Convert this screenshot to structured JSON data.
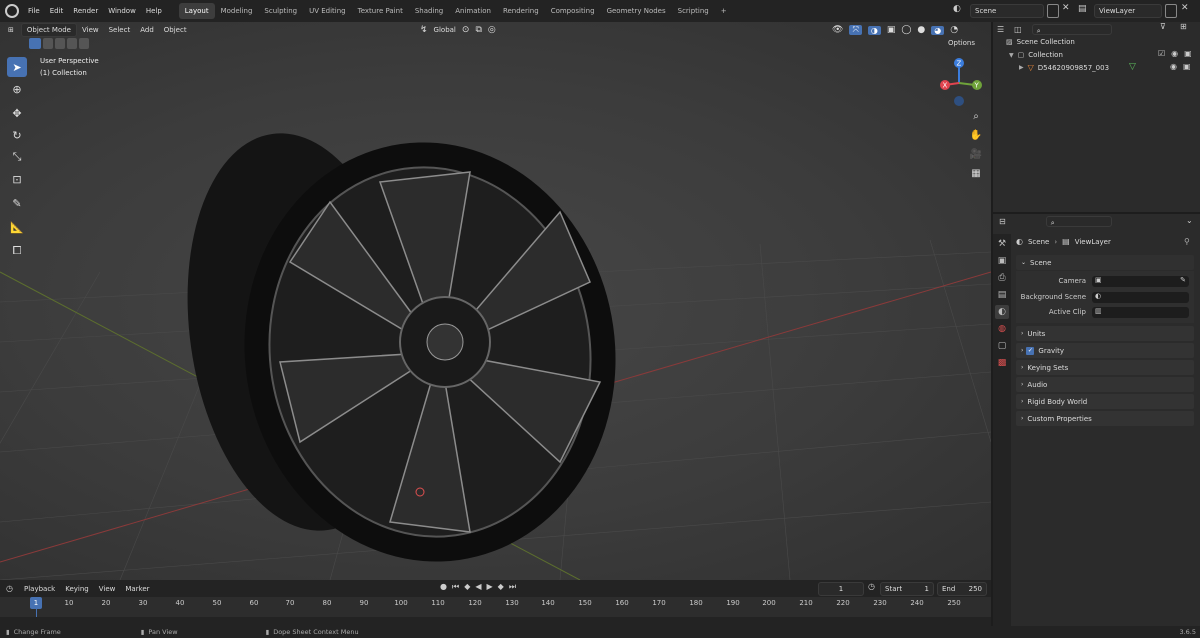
{
  "menubar": {
    "items": [
      "File",
      "Edit",
      "Render",
      "Window",
      "Help"
    ]
  },
  "workspace_tabs": [
    "Layout",
    "Modeling",
    "Sculpting",
    "UV Editing",
    "Texture Paint",
    "Shading",
    "Animation",
    "Rendering",
    "Compositing",
    "Geometry Nodes",
    "Scripting"
  ],
  "active_tab": "Layout",
  "add_tab": "+",
  "scene": {
    "name": "Scene",
    "viewlayer": "ViewLayer"
  },
  "viewport": {
    "mode": "Object Mode",
    "menus": [
      "View",
      "Select",
      "Add",
      "Object"
    ],
    "orientation": "Global",
    "options": "Options",
    "overlay_title": "User Perspective",
    "overlay_sub": "(1) Collection",
    "gizmo": {
      "x": "X",
      "y": "Y",
      "z": "Z"
    },
    "colors": {
      "x": "#e0444f",
      "y": "#6fa33a",
      "z": "#3b7ddd"
    }
  },
  "outliner": {
    "root": "Scene Collection",
    "collection": "Collection",
    "object": "D54620909857_003"
  },
  "properties": {
    "breadcrumb": [
      "Scene",
      "ViewLayer"
    ],
    "section": "Scene",
    "fields": [
      {
        "label": "Camera"
      },
      {
        "label": "Background Scene"
      },
      {
        "label": "Active Clip"
      }
    ],
    "panels": [
      "Units",
      "Gravity",
      "Keying Sets",
      "Audio",
      "Rigid Body World",
      "Custom Properties"
    ]
  },
  "timeline": {
    "menus": [
      "Playback",
      "Keying",
      "View",
      "Marker"
    ],
    "current_frame": "1",
    "start_label": "Start",
    "start": "1",
    "end_label": "End",
    "end": "250",
    "ruler": [
      "1",
      "10",
      "20",
      "30",
      "40",
      "50",
      "60",
      "70",
      "80",
      "90",
      "100",
      "110",
      "120",
      "130",
      "140",
      "150",
      "160",
      "170",
      "180",
      "190",
      "200",
      "210",
      "220",
      "230",
      "240",
      "250"
    ]
  },
  "status": {
    "change_frame": "Change Frame",
    "pan_view": "Pan View",
    "context_menu": "Dope Sheet Context Menu",
    "version": "3.6.5"
  }
}
